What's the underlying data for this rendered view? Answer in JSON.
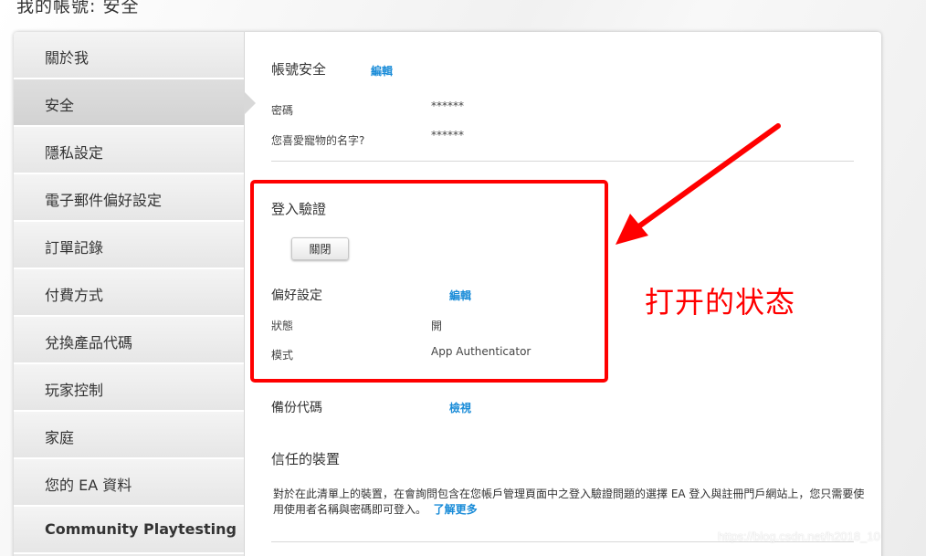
{
  "page": {
    "title": "我的帳號: 安全"
  },
  "sidebar": {
    "items": [
      {
        "label": "關於我"
      },
      {
        "label": "安全"
      },
      {
        "label": "隱私設定"
      },
      {
        "label": "電子郵件偏好設定"
      },
      {
        "label": "訂單記錄"
      },
      {
        "label": "付費方式"
      },
      {
        "label": "兌換產品代碼"
      },
      {
        "label": "玩家控制"
      },
      {
        "label": "家庭"
      },
      {
        "label": "您的 EA 資料"
      },
      {
        "label": "Community Playtesting"
      }
    ],
    "active_index": 1
  },
  "account_security": {
    "title": "帳號安全",
    "edit_label": "編輯",
    "password_label": "密碼",
    "password_value": "******",
    "pet_label": "您喜愛寵物的名字?",
    "pet_value": "******"
  },
  "login_verification": {
    "title": "登入驗證",
    "close_button": "關閉",
    "preferences_title": "偏好設定",
    "preferences_edit": "編輯",
    "status_label": "狀態",
    "status_value": "開",
    "mode_label": "模式",
    "mode_value": "App Authenticator"
  },
  "backup_codes": {
    "title": "備份代碼",
    "view_label": "檢視"
  },
  "trusted_devices": {
    "title": "信任的裝置",
    "description": "對於在此清單上的裝置，在會詢問包含在您帳戶管理頁面中之登入驗證問題的選擇 EA 登入與註冊門戶網站上，您只需要使用使用者名稱與密碼即可登入。",
    "learn_more": "了解更多"
  },
  "annotation": {
    "text": "打开的状态",
    "color": "#ff0000"
  },
  "watermark": {
    "text": "https://blog.csdn.net/h2018_10"
  },
  "colors": {
    "link": "#1a8cd8",
    "highlight": "#ff0000"
  }
}
